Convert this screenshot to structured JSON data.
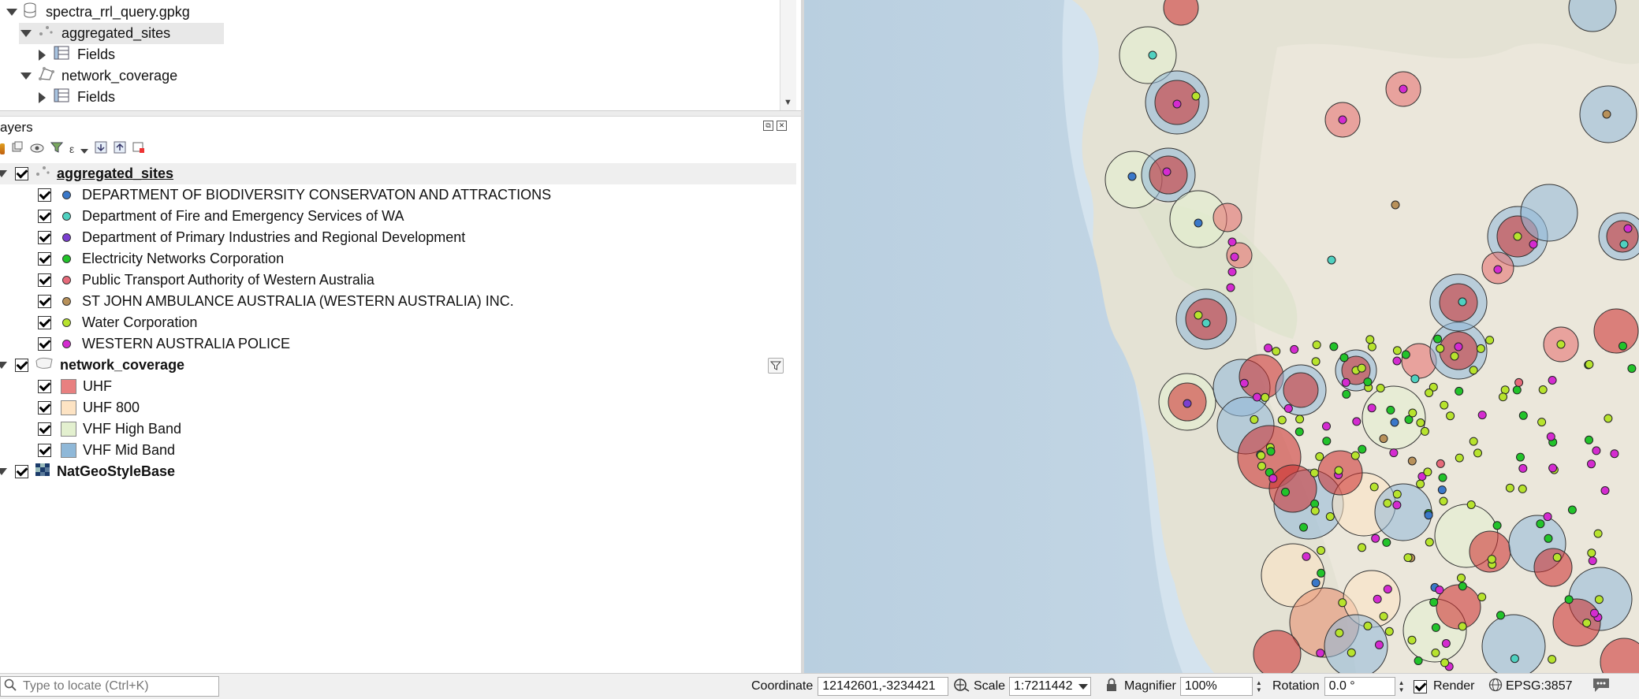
{
  "browser": {
    "items": [
      {
        "label": "spectra_rrl_query.gpkg"
      },
      {
        "label": "aggregated_sites"
      },
      {
        "label": "Fields"
      },
      {
        "label": "network_coverage"
      },
      {
        "label": "Fields"
      }
    ]
  },
  "layers_panel": {
    "title": "ayers"
  },
  "layers": {
    "aggregated_sites": {
      "name": "aggregated_sites",
      "classes": [
        {
          "label": "DEPARTMENT OF BIODIVERSITY CONSERVATON AND ATTRACTIONS",
          "color": "#3a78c9"
        },
        {
          "label": "Department of Fire and Emergency Services of WA",
          "color": "#4fd1c0"
        },
        {
          "label": "Department of Primary Industries and Regional Development",
          "color": "#7b3fd0"
        },
        {
          "label": "Electricity Networks Corporation",
          "color": "#22c32a"
        },
        {
          "label": "Public Transport Authority of Western Australia",
          "color": "#e66a7a"
        },
        {
          "label": "ST JOHN AMBULANCE AUSTRALIA (WESTERN AUSTRALIA) INC.",
          "color": "#b8915a"
        },
        {
          "label": "Water Corporation",
          "color": "#b7e32d"
        },
        {
          "label": "WESTERN AUSTRALIA POLICE",
          "color": "#d42bd0"
        }
      ]
    },
    "network_coverage": {
      "name": "network_coverage",
      "classes": [
        {
          "label": "UHF",
          "color": "#e88080"
        },
        {
          "label": "UHF 800",
          "color": "#fde3c3"
        },
        {
          "label": "VHF High Band",
          "color": "#e3f0cf"
        },
        {
          "label": "VHF Mid Band",
          "color": "#8fb8d8"
        }
      ]
    },
    "basemap": {
      "name": "NatGeoStyleBase"
    }
  },
  "statusbar": {
    "locate_placeholder": "Type to locate (Ctrl+K)",
    "coordinate_label": "Coordinate",
    "coordinate_value": "12142601,-3234421",
    "scale_label": "Scale",
    "scale_value": "1:7211442",
    "magnifier_label": "Magnifier",
    "magnifier_value": "100%",
    "rotation_label": "Rotation",
    "rotation_value": "0.0 °",
    "render_label": "Render",
    "crs_label": "EPSG:3857"
  }
}
